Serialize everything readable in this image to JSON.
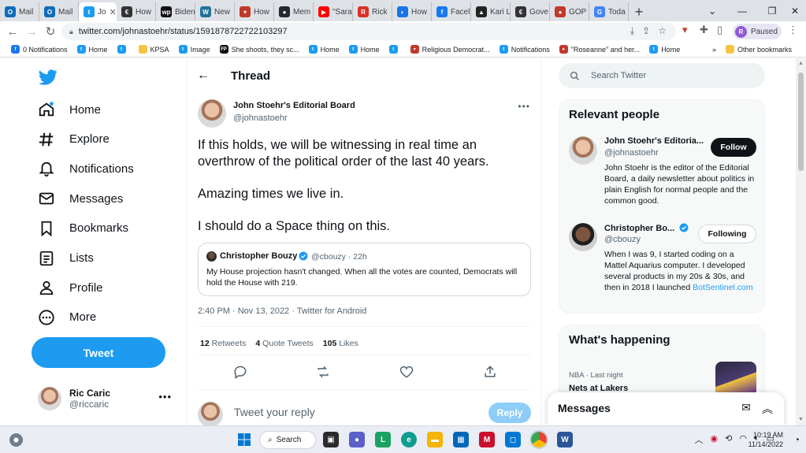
{
  "browser": {
    "tabs": [
      {
        "label": "Mail",
        "icon": "outlook-icon",
        "color": "#0f6cbd",
        "glyph": "O"
      },
      {
        "label": "Mail",
        "icon": "outlook-icon",
        "color": "#0f6cbd",
        "glyph": "O"
      },
      {
        "label": "Jo",
        "icon": "twitter-icon",
        "color": "#1d9bf0",
        "glyph": "t",
        "active": true
      },
      {
        "label": "How",
        "icon": "news-icon",
        "color": "#333333",
        "glyph": "€"
      },
      {
        "label": "Biden",
        "icon": "wp-icon",
        "color": "#111111",
        "glyph": "wp"
      },
      {
        "label": "New",
        "icon": "wordpress-icon",
        "color": "#21759b",
        "glyph": "W"
      },
      {
        "label": "How",
        "icon": "topic-icon",
        "color": "#c0392b",
        "glyph": "▾"
      },
      {
        "label": "Mem",
        "icon": "github-icon",
        "color": "#24292f",
        "glyph": "●"
      },
      {
        "label": "\"Sara",
        "icon": "youtube-icon",
        "color": "#ff0000",
        "glyph": "▶"
      },
      {
        "label": "Rick",
        "icon": "rick-icon",
        "color": "#d93025",
        "glyph": "R"
      },
      {
        "label": "How",
        "icon": "blue-icon",
        "color": "#1a73e8",
        "glyph": "◐"
      },
      {
        "label": "Facel",
        "icon": "facebook-icon",
        "color": "#1877f2",
        "glyph": "f"
      },
      {
        "label": "Kari L",
        "icon": "kari-icon",
        "color": "#222222",
        "glyph": "▲"
      },
      {
        "label": "Gove",
        "icon": "news-icon",
        "color": "#333333",
        "glyph": "€"
      },
      {
        "label": "GOP",
        "icon": "gop-icon",
        "color": "#c0392b",
        "glyph": "●"
      },
      {
        "label": "Toda",
        "icon": "google-icon",
        "color": "#4285f4",
        "glyph": "G"
      }
    ],
    "url": "twitter.com/johnastoehr/status/1591878722722103297",
    "profile_status": "Paused",
    "profile_initial": "R",
    "bookmarks": [
      {
        "label": "0 Notifications",
        "icon": "facebook-icon",
        "color": "#1877f2",
        "glyph": "f"
      },
      {
        "label": "Home",
        "icon": "twitter-icon",
        "color": "#1d9bf0",
        "glyph": "t"
      },
      {
        "label": "",
        "icon": "twitter-icon",
        "color": "#1d9bf0",
        "glyph": "t"
      },
      {
        "label": "KPSA",
        "icon": "folder-icon",
        "color": "#f4c542",
        "glyph": ""
      },
      {
        "label": "Image",
        "icon": "twitter-icon",
        "color": "#1d9bf0",
        "glyph": "t"
      },
      {
        "label": "She shoots, they sc...",
        "icon": "fp-icon",
        "color": "#111111",
        "glyph": "FP"
      },
      {
        "label": "Home",
        "icon": "twitter-icon",
        "color": "#1d9bf0",
        "glyph": "t"
      },
      {
        "label": "Home",
        "icon": "twitter-icon",
        "color": "#1d9bf0",
        "glyph": "t"
      },
      {
        "label": "",
        "icon": "twitter-icon",
        "color": "#1d9bf0",
        "glyph": "t"
      },
      {
        "label": "Religious Democrat...",
        "icon": "topic-icon",
        "color": "#c0392b",
        "glyph": "▾"
      },
      {
        "label": "Notifications",
        "icon": "twitter-icon",
        "color": "#1d9bf0",
        "glyph": "t"
      },
      {
        "label": "\"Roseanne\" and her...",
        "icon": "gop-icon",
        "color": "#c0392b",
        "glyph": "●"
      },
      {
        "label": "Home",
        "icon": "twitter-icon",
        "color": "#1d9bf0",
        "glyph": "t"
      }
    ],
    "bookmarks_more": "»",
    "other_bookmarks": "Other bookmarks"
  },
  "nav": {
    "items": [
      {
        "label": "Home",
        "icon": "home-icon"
      },
      {
        "label": "Explore",
        "icon": "hashtag-icon"
      },
      {
        "label": "Notifications",
        "icon": "bell-icon"
      },
      {
        "label": "Messages",
        "icon": "envelope-icon"
      },
      {
        "label": "Bookmarks",
        "icon": "bookmark-icon"
      },
      {
        "label": "Lists",
        "icon": "list-icon"
      },
      {
        "label": "Profile",
        "icon": "person-icon"
      },
      {
        "label": "More",
        "icon": "more-circle-icon"
      }
    ],
    "tweet_button": "Tweet",
    "account": {
      "name": "Ric Caric",
      "handle": "@riccaric"
    }
  },
  "thread": {
    "title": "Thread",
    "author": {
      "name": "John Stoehr's Editorial Board",
      "handle": "@johnastoehr"
    },
    "text": [
      "If this holds, we will be witnessing in real time an overthrow of the political order of the last 40 years.",
      "Amazing times we live in.",
      "I should do a Space thing on this."
    ],
    "quote": {
      "name": "Christopher Bouzy",
      "handle": "@cbouzy · 22h",
      "text": "My House projection hasn't changed. When all the votes are counted, Democrats will hold the House with 219."
    },
    "meta": "2:40 PM · Nov 13, 2022 · Twitter for Android",
    "stats": {
      "retweets_count": "12",
      "retweets_label": "Retweets",
      "quotes_count": "4",
      "quotes_label": "Quote Tweets",
      "likes_count": "105",
      "likes_label": "Likes"
    },
    "reply_placeholder": "Tweet your reply",
    "reply_button": "Reply"
  },
  "sidebar": {
    "search_placeholder": "Search Twitter",
    "relevant": {
      "title": "Relevant people",
      "people": [
        {
          "name": "John Stoehr's Editoria...",
          "handle": "@johnastoehr",
          "bio": "John Stoehr is the editor of the Editorial Board, a daily newsletter about politics in plain English for normal people and the common good.",
          "button": "Follow"
        },
        {
          "name": "Christopher Bo...",
          "handle": "@cbouzy",
          "bio": "When I was 9, I started coding on a Mattel Aquarius computer. I developed several products in my 20s & 30s, and then in 2018 I launched",
          "link": "BotSentinel.com",
          "button": "Following"
        }
      ]
    },
    "happening": {
      "title": "What's happening",
      "trend_meta": "NBA · Last night",
      "trend_name": "Nets at Lakers"
    },
    "messages_dock": "Messages"
  },
  "taskbar": {
    "search_label": "Search",
    "time": "10:19 AM",
    "date": "11/14/2022"
  },
  "colors": {
    "twitter_blue": "#1d9bf0",
    "verified_blue": "#1d9bf0",
    "reply_disabled": "#8ecdf8"
  }
}
